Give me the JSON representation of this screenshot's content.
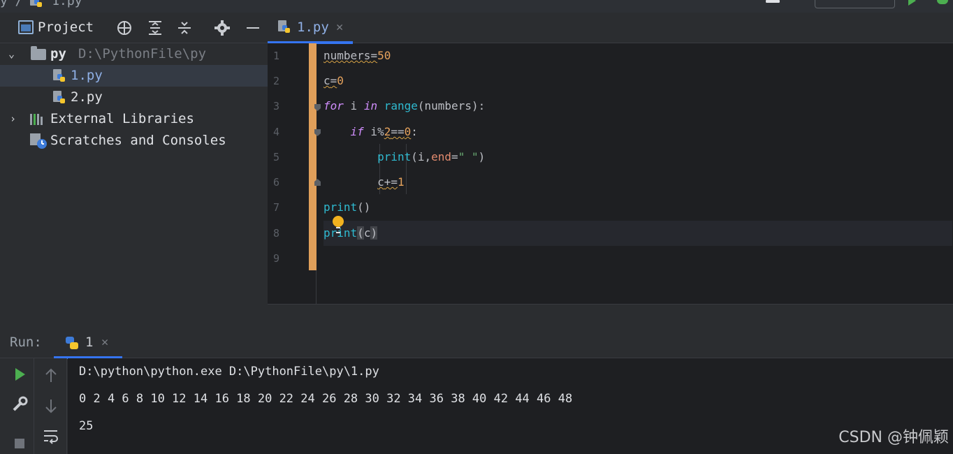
{
  "breadcrumb": {
    "file": "1.py"
  },
  "project_panel": {
    "title": "Project",
    "tree": {
      "root_name": "py",
      "root_path": "D:\\PythonFile\\py",
      "files": [
        "1.py",
        "2.py"
      ],
      "external_libraries": "External Libraries",
      "scratches": "Scratches and Consoles"
    }
  },
  "editor": {
    "active_tab": "1.py",
    "line_numbers": [
      "1",
      "2",
      "3",
      "4",
      "5",
      "6",
      "7",
      "8",
      "9"
    ],
    "code": {
      "l1": {
        "var": "numbers",
        "op": "=",
        "val": "50"
      },
      "l2": {
        "var": "c",
        "op": "=",
        "val": "0"
      },
      "l3": {
        "kw_for": "for",
        "i": " i ",
        "kw_in": "in",
        "fn": "range",
        "rest": "(numbers):"
      },
      "l4": {
        "kw_if": "if",
        "cond1": " i%",
        "n2": "2",
        "eq": "==",
        "n0": "0",
        "colon": ":"
      },
      "l5": {
        "fn": "print",
        "open": "(i,",
        "kwarg": "end",
        "eq": "=",
        "str": "\" \"",
        "close": ")"
      },
      "l6": {
        "var": "c",
        "op": "+=",
        "val": "1"
      },
      "l7": {
        "fn": "print",
        "args": "()"
      },
      "l8": {
        "fn": "print",
        "open": "(",
        "arg": "c",
        "close": ")"
      }
    }
  },
  "run_panel": {
    "label": "Run:",
    "tab": "1",
    "output": [
      "D:\\python\\python.exe D:\\PythonFile\\py\\1.py",
      "0 2 4 6 8 10 12 14 16 18 20 22 24 26 28 30 32 34 36 38 40 42 44 46 48",
      "25"
    ]
  },
  "watermark": "CSDN @钟佩颖",
  "icons": [
    "python-file-icon",
    "crosshair-icon",
    "expand-all-icon",
    "collapse-all-icon",
    "gear-icon",
    "minimize-icon",
    "folder-icon",
    "library-icon",
    "scratches-icon",
    "run-icon",
    "wrench-icon",
    "stop-icon",
    "arrow-up-icon",
    "arrow-down-icon",
    "soft-wrap-icon",
    "close-icon",
    "lightbulb-icon"
  ],
  "colors": {
    "accent": "#3574f0",
    "change_bar": "#e09f5a",
    "run_green": "#4caf50"
  }
}
